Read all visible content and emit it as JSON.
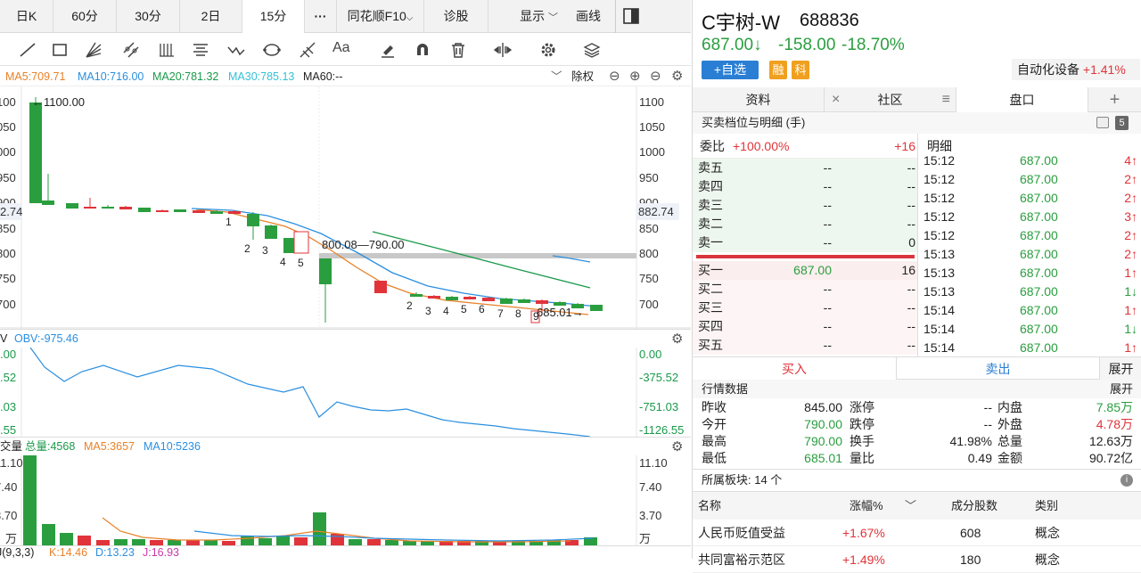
{
  "tabs": [
    "日K",
    "60分",
    "30分",
    "2日",
    "15分",
    "···",
    "同花顺F10",
    "诊股",
    "显示",
    "画线"
  ],
  "ma": {
    "ma5": "MA5:709.71",
    "ma10": "MA10:716.00",
    "ma20": "MA20:781.32",
    "ma30": "MA30:785.13",
    "ma60": "MA60:--",
    "exright": "除权"
  },
  "price_axis_right": [
    "1100",
    "1050",
    "1000",
    "950",
    "900",
    "850",
    "800",
    "750",
    "700"
  ],
  "price_axis_left": [
    "100",
    "050",
    "000",
    "950",
    "900",
    "850",
    "800",
    "750",
    "700"
  ],
  "cursor_price": "882.74",
  "cursor_price_left": "2.74",
  "high_label": "←1100.00",
  "low_label": "685.01→",
  "gap_label": "800.08—790.00",
  "seq_a": [
    "1",
    "2",
    "3",
    "4",
    "5"
  ],
  "seq_b": [
    "2",
    "3",
    "4",
    "5",
    "6",
    "7",
    "8",
    "9"
  ],
  "obv": {
    "title": "V",
    "label": "OBV:-975.46",
    "right": [
      "0.00",
      "-375.52",
      "-751.03",
      "-1126.55"
    ],
    "left": [
      ".00",
      ".52",
      ".03",
      ".55"
    ]
  },
  "vol": {
    "title": "交量",
    "total": "总量:4568",
    "ma5": "MA5:3657",
    "ma10": "MA10:5236",
    "right": [
      "11.10",
      "7.40",
      "3.70",
      "万"
    ],
    "left": [
      "11.10",
      "7.40",
      "3.70",
      "万"
    ]
  },
  "kdj": {
    "title": "J(9,3,3)",
    "k": "K:14.46",
    "d": "D:13.23",
    "j": "J:16.93"
  },
  "stock": {
    "name": "C宇树-W",
    "code": "688836",
    "price": "687.00↓",
    "change": "-158.00",
    "pct": "-18.70%",
    "add": "+自选",
    "tag1": "融",
    "tag2": "科",
    "sector": "自动化设备",
    "sector_pct": "+1.41%"
  },
  "panel_tabs": [
    "资料",
    "社区",
    "盘口"
  ],
  "orderbook": {
    "title": "买卖档位与明细 (手)",
    "badge": "5",
    "weibi_label": "委比",
    "weibi": "+100.00%",
    "weibi_diff": "+16",
    "asks": [
      {
        "l": "卖五",
        "p": "--",
        "v": "--"
      },
      {
        "l": "卖四",
        "p": "--",
        "v": "--"
      },
      {
        "l": "卖三",
        "p": "--",
        "v": "--"
      },
      {
        "l": "卖二",
        "p": "--",
        "v": "--"
      },
      {
        "l": "卖一",
        "p": "--",
        "v": "0"
      }
    ],
    "bids": [
      {
        "l": "买一",
        "p": "687.00",
        "v": "16"
      },
      {
        "l": "买二",
        "p": "--",
        "v": "--"
      },
      {
        "l": "买三",
        "p": "--",
        "v": "--"
      },
      {
        "l": "买四",
        "p": "--",
        "v": "--"
      },
      {
        "l": "买五",
        "p": "--",
        "v": "--"
      }
    ]
  },
  "detail": {
    "title": "明细",
    "rows": [
      {
        "t": "15:12",
        "p": "687.00",
        "v": "4↑"
      },
      {
        "t": "15:12",
        "p": "687.00",
        "v": "2↑"
      },
      {
        "t": "15:12",
        "p": "687.00",
        "v": "2↑"
      },
      {
        "t": "15:12",
        "p": "687.00",
        "v": "3↑"
      },
      {
        "t": "15:12",
        "p": "687.00",
        "v": "2↑"
      },
      {
        "t": "15:13",
        "p": "687.00",
        "v": "2↑"
      },
      {
        "t": "15:13",
        "p": "687.00",
        "v": "1↑"
      },
      {
        "t": "15:13",
        "p": "687.00",
        "v": "1↓"
      },
      {
        "t": "15:14",
        "p": "687.00",
        "v": "1↑"
      },
      {
        "t": "15:14",
        "p": "687.00",
        "v": "1↓"
      },
      {
        "t": "15:14",
        "p": "687.00",
        "v": "1↑"
      }
    ]
  },
  "trade": {
    "buy": "买入",
    "sell": "卖出",
    "expand": "展开"
  },
  "quote": {
    "title": "行情数据",
    "expand": "展开",
    "rows": [
      [
        "昨收",
        "845.00",
        "涨停",
        "--",
        "内盘",
        "7.85万"
      ],
      [
        "今开",
        "790.00",
        "跌停",
        "--",
        "外盘",
        "4.78万"
      ],
      [
        "最高",
        "790.00",
        "换手",
        "41.98%",
        "总量",
        "12.63万"
      ],
      [
        "最低",
        "685.01",
        "量比",
        "0.49",
        "金额",
        "90.72亿"
      ]
    ]
  },
  "sectors": {
    "title": "所属板块: 14 个",
    "headers": [
      "名称",
      "涨幅%",
      "成分股数",
      "类别"
    ],
    "rows": [
      {
        "name": "人民币贬值受益",
        "pct": "+1.67%",
        "count": "608",
        "type": "概念"
      },
      {
        "name": "共同富裕示范区",
        "pct": "+1.49%",
        "count": "180",
        "type": "概念"
      }
    ]
  },
  "colors": {
    "up": "#e0343a",
    "down": "#2a9e3f",
    "ma5": "#e8822a",
    "ma10": "#2b8fe0",
    "ma20": "#1a9a4a",
    "ma30": "#35c0d6",
    "blue": "#2a7fd4"
  }
}
